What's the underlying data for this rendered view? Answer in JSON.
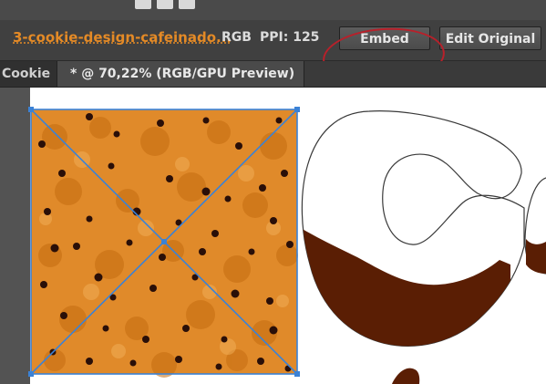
{
  "control_bar": {
    "filename": "3-cookie-design-cafeinado...",
    "color_mode": "RGB",
    "ppi": "PPI: 125",
    "embed_label": "Embed",
    "edit_original_label": "Edit Original"
  },
  "tabs": [
    {
      "label": "Cookie"
    },
    {
      "label": "* @ 70,22% (RGB/GPU Preview)"
    }
  ],
  "colors": {
    "accent_filename": "#e48a26",
    "annotation_circle": "#b8202a",
    "selection_blue": "#3b82d6",
    "chocolate": "#5a1e04",
    "cookie_dough": "#e08a2a"
  }
}
